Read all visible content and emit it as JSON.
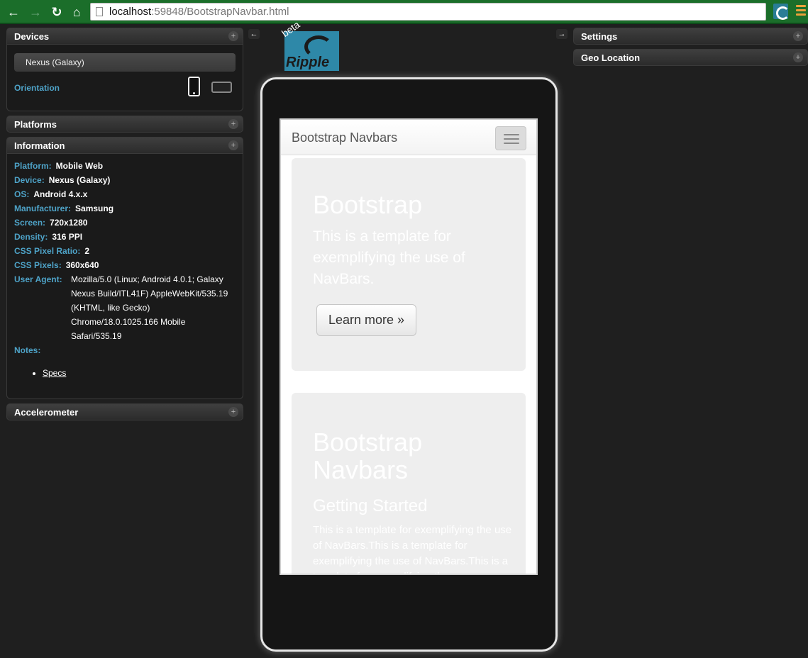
{
  "browser": {
    "url_host": "localhost",
    "url_rest": ":59848/BootstrapNavbar.html",
    "icons": [
      "back-arrow-icon",
      "forward-arrow-icon",
      "reload-icon",
      "home-icon",
      "page-icon",
      "ripple-extension-icon",
      "menu-icon"
    ]
  },
  "left_panels": {
    "devices": {
      "title": "Devices",
      "selected_device": "Nexus (Galaxy)",
      "orientation_label": "Orientation"
    },
    "platforms": {
      "title": "Platforms"
    },
    "information": {
      "title": "Information",
      "rows": [
        {
          "key": "Platform:",
          "value": "Mobile Web"
        },
        {
          "key": "Device:",
          "value": "Nexus (Galaxy)"
        },
        {
          "key": "OS:",
          "value": "Android 4.x.x"
        },
        {
          "key": "Manufacturer:",
          "value": "Samsung"
        },
        {
          "key": "Screen:",
          "value": "720x1280"
        },
        {
          "key": "Density:",
          "value": "316 PPI"
        },
        {
          "key": "CSS Pixel Ratio:",
          "value": "2"
        },
        {
          "key": "CSS Pixels:",
          "value": "360x640"
        }
      ],
      "user_agent_label": "User Agent:",
      "user_agent_lines": [
        "Mozilla/5.0 (Linux; Android 4.0.1; Galaxy",
        "Nexus Build/ITL41F) AppleWebKit/535.19",
        "(KHTML, like Gecko)",
        "Chrome/18.0.1025.166 Mobile",
        "Safari/535.19"
      ],
      "notes_label": "Notes:",
      "notes_link": "Specs"
    },
    "accelerometer": {
      "title": "Accelerometer"
    }
  },
  "right_panels": {
    "settings": {
      "title": "Settings"
    },
    "geo_location": {
      "title": "Geo Location"
    }
  },
  "logo": {
    "word": "Ripple",
    "beta": "beta"
  },
  "app": {
    "brand": "Bootstrap Navbars",
    "jumbo1": {
      "heading": "Bootstrap",
      "lead": "This is a template for exemplifying the use of NavBars.",
      "button": "Learn more »"
    },
    "jumbo2": {
      "heading_line1": "Bootstrap",
      "heading_line2": "Navbars",
      "subheading": "Getting Started",
      "paragraph": "This is a template for exemplifying the use of NavBars.This is a template for exemplifying the use of NavBars.This is a template for exemplifying the use"
    }
  }
}
